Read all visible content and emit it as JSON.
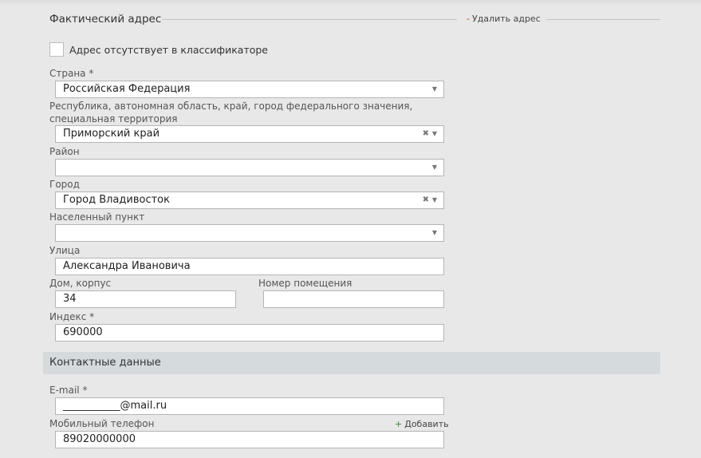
{
  "address_section": {
    "title": "Фактический адрес",
    "remove_link_sign": "-",
    "remove_link_text": "Удалить адрес"
  },
  "not_in_classifier": {
    "label": "Адрес отсутствует в классификаторе",
    "checked": false
  },
  "fields": {
    "country": {
      "label": "Страна *",
      "value": "Российская Федерация"
    },
    "region": {
      "label_line1": "Республика, автономная область, край, город федерального значения,",
      "label_line2": "специальная территория",
      "value": "Приморский край"
    },
    "district": {
      "label": "Район",
      "value": ""
    },
    "city": {
      "label": "Город",
      "value": "Город Владивосток"
    },
    "settlement": {
      "label": "Населенный пункт",
      "value": ""
    },
    "street": {
      "label": "Улица",
      "value": "Александра Ивановича"
    },
    "house": {
      "label": "Дом, корпус",
      "value": "34"
    },
    "apartment": {
      "label": "Номер помещения",
      "value": ""
    },
    "postcode": {
      "label": "Индекс *",
      "value": "690000"
    }
  },
  "contacts_section": {
    "title": "Контактные данные",
    "email": {
      "label": "E-mail *",
      "value": "___________@mail.ru"
    },
    "mobile": {
      "label": "Мобильный телефон",
      "value": "89020000000",
      "add_sign": "+",
      "add_text": "Добавить"
    }
  },
  "icons": {
    "dropdown": "▼",
    "clear": "✖"
  },
  "colors": {
    "background": "#e8e8e8",
    "contacts_band": "#d5dadd",
    "remove_sign": "#c0392b",
    "add_sign": "#2e8b2e"
  }
}
